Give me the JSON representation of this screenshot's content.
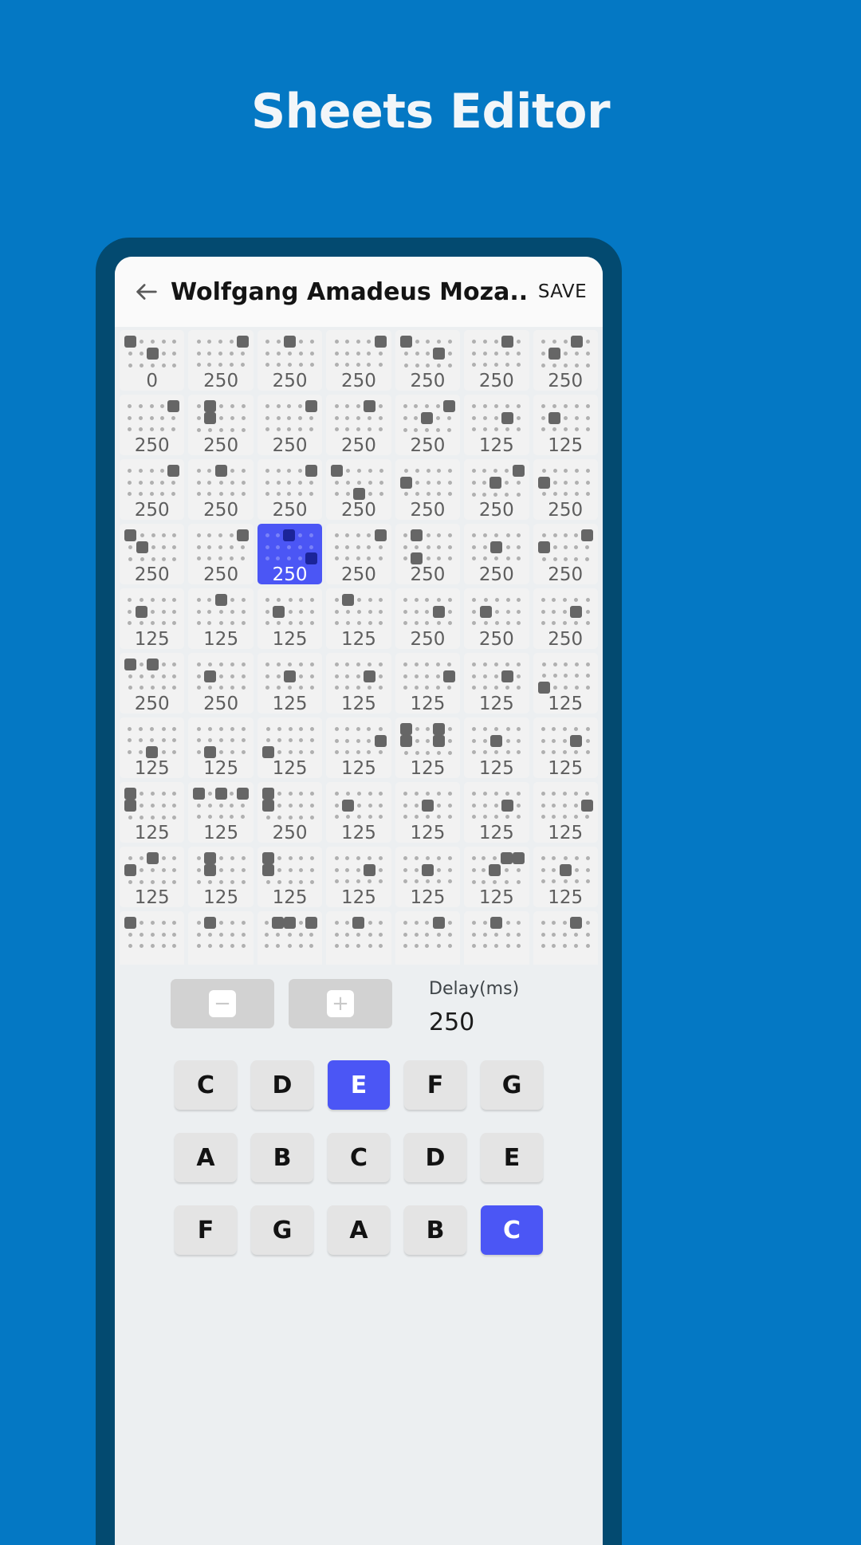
{
  "promo": {
    "title": "Sheets Editor"
  },
  "appbar": {
    "back_icon": "arrow-left-icon",
    "title": "Wolfgang Amadeus Moza...",
    "save_label": "SAVE"
  },
  "colors": {
    "page_background": "#0478c4",
    "phone_frame": "#034a70",
    "screen_background": "#eceff1",
    "appbar_background": "#fafafa",
    "cell_background": "#f2f2f2",
    "accent_selected": "#4b56f5",
    "dot_off": "#b0b0b0",
    "dot_on": "#666666",
    "key_background": "#e4e4e4"
  },
  "grid": {
    "columns": 7,
    "dot_columns": 5,
    "dot_rows": 3,
    "rows": [
      [
        {
          "delay": "0",
          "notes": [
            [
              0,
              0
            ],
            [
              2,
              1
            ]
          ],
          "selected": false
        },
        {
          "delay": "250",
          "notes": [
            [
              4,
              0
            ]
          ],
          "selected": false
        },
        {
          "delay": "250",
          "notes": [
            [
              2,
              0
            ]
          ],
          "selected": false
        },
        {
          "delay": "250",
          "notes": [
            [
              4,
              0
            ]
          ],
          "selected": false
        },
        {
          "delay": "250",
          "notes": [
            [
              0,
              0
            ],
            [
              3,
              1
            ]
          ],
          "selected": false
        },
        {
          "delay": "250",
          "notes": [
            [
              3,
              0
            ]
          ],
          "selected": false
        },
        {
          "delay": "250",
          "notes": [
            [
              3,
              0
            ],
            [
              1,
              1
            ]
          ],
          "selected": false
        }
      ],
      [
        {
          "delay": "250",
          "notes": [
            [
              4,
              0
            ]
          ],
          "selected": false
        },
        {
          "delay": "250",
          "notes": [
            [
              1,
              0
            ],
            [
              1,
              1
            ]
          ],
          "selected": false
        },
        {
          "delay": "250",
          "notes": [
            [
              4,
              0
            ]
          ],
          "selected": false
        },
        {
          "delay": "250",
          "notes": [
            [
              3,
              0
            ]
          ],
          "selected": false
        },
        {
          "delay": "250",
          "notes": [
            [
              4,
              0
            ],
            [
              2,
              1
            ]
          ],
          "selected": false
        },
        {
          "delay": "125",
          "notes": [
            [
              3,
              1
            ]
          ],
          "selected": false
        },
        {
          "delay": "125",
          "notes": [
            [
              1,
              1
            ]
          ],
          "selected": false
        }
      ],
      [
        {
          "delay": "250",
          "notes": [
            [
              4,
              0
            ]
          ],
          "selected": false
        },
        {
          "delay": "250",
          "notes": [
            [
              2,
              0
            ]
          ],
          "selected": false
        },
        {
          "delay": "250",
          "notes": [
            [
              4,
              0
            ]
          ],
          "selected": false
        },
        {
          "delay": "250",
          "notes": [
            [
              0,
              0
            ],
            [
              2,
              2
            ]
          ],
          "selected": false
        },
        {
          "delay": "250",
          "notes": [
            [
              0,
              1
            ]
          ],
          "selected": false
        },
        {
          "delay": "250",
          "notes": [
            [
              4,
              0
            ],
            [
              2,
              1
            ]
          ],
          "selected": false
        },
        {
          "delay": "250",
          "notes": [
            [
              0,
              1
            ]
          ],
          "selected": false
        }
      ],
      [
        {
          "delay": "250",
          "notes": [
            [
              0,
              0
            ],
            [
              1,
              1
            ]
          ],
          "selected": false
        },
        {
          "delay": "250",
          "notes": [
            [
              4,
              0
            ]
          ],
          "selected": false
        },
        {
          "delay": "250",
          "notes": [
            [
              2,
              0
            ],
            [
              4,
              2
            ]
          ],
          "selected": true
        },
        {
          "delay": "250",
          "notes": [
            [
              4,
              0
            ]
          ],
          "selected": false
        },
        {
          "delay": "250",
          "notes": [
            [
              1,
              0
            ],
            [
              1,
              2
            ]
          ],
          "selected": false
        },
        {
          "delay": "250",
          "notes": [
            [
              2,
              1
            ]
          ],
          "selected": false
        },
        {
          "delay": "250",
          "notes": [
            [
              0,
              1
            ],
            [
              4,
              0
            ]
          ],
          "selected": false
        }
      ],
      [
        {
          "delay": "125",
          "notes": [
            [
              1,
              1
            ]
          ],
          "selected": false
        },
        {
          "delay": "125",
          "notes": [
            [
              2,
              0
            ]
          ],
          "selected": false
        },
        {
          "delay": "125",
          "notes": [
            [
              1,
              1
            ]
          ],
          "selected": false
        },
        {
          "delay": "125",
          "notes": [
            [
              1,
              0
            ]
          ],
          "selected": false
        },
        {
          "delay": "250",
          "notes": [
            [
              3,
              1
            ]
          ],
          "selected": false
        },
        {
          "delay": "250",
          "notes": [
            [
              1,
              1
            ]
          ],
          "selected": false
        },
        {
          "delay": "250",
          "notes": [
            [
              3,
              1
            ]
          ],
          "selected": false
        }
      ],
      [
        {
          "delay": "250",
          "notes": [
            [
              0,
              0
            ],
            [
              2,
              0
            ]
          ],
          "selected": false
        },
        {
          "delay": "250",
          "notes": [
            [
              1,
              1
            ]
          ],
          "selected": false
        },
        {
          "delay": "125",
          "notes": [
            [
              2,
              1
            ]
          ],
          "selected": false
        },
        {
          "delay": "125",
          "notes": [
            [
              3,
              1
            ]
          ],
          "selected": false
        },
        {
          "delay": "125",
          "notes": [
            [
              4,
              1
            ]
          ],
          "selected": false
        },
        {
          "delay": "125",
          "notes": [
            [
              3,
              1
            ]
          ],
          "selected": false
        },
        {
          "delay": "125",
          "notes": [
            [
              0,
              2
            ]
          ],
          "selected": false
        }
      ],
      [
        {
          "delay": "125",
          "notes": [
            [
              2,
              2
            ]
          ],
          "selected": false
        },
        {
          "delay": "125",
          "notes": [
            [
              1,
              2
            ]
          ],
          "selected": false
        },
        {
          "delay": "125",
          "notes": [
            [
              0,
              2
            ]
          ],
          "selected": false
        },
        {
          "delay": "125",
          "notes": [
            [
              4,
              1
            ]
          ],
          "selected": false
        },
        {
          "delay": "125",
          "notes": [
            [
              0,
              0
            ],
            [
              3,
              0
            ],
            [
              0,
              1
            ],
            [
              3,
              1
            ]
          ],
          "selected": false
        },
        {
          "delay": "125",
          "notes": [
            [
              2,
              1
            ]
          ],
          "selected": false
        },
        {
          "delay": "125",
          "notes": [
            [
              3,
              1
            ]
          ],
          "selected": false
        }
      ],
      [
        {
          "delay": "125",
          "notes": [
            [
              0,
              0
            ],
            [
              0,
              1
            ]
          ],
          "selected": false
        },
        {
          "delay": "125",
          "notes": [
            [
              0,
              0
            ],
            [
              2,
              0
            ],
            [
              4,
              0
            ]
          ],
          "selected": false
        },
        {
          "delay": "250",
          "notes": [
            [
              0,
              0
            ],
            [
              0,
              1
            ]
          ],
          "selected": false
        },
        {
          "delay": "125",
          "notes": [
            [
              1,
              1
            ]
          ],
          "selected": false
        },
        {
          "delay": "125",
          "notes": [
            [
              2,
              1
            ]
          ],
          "selected": false
        },
        {
          "delay": "125",
          "notes": [
            [
              3,
              1
            ]
          ],
          "selected": false
        },
        {
          "delay": "125",
          "notes": [
            [
              4,
              1
            ]
          ],
          "selected": false
        }
      ],
      [
        {
          "delay": "125",
          "notes": [
            [
              0,
              1
            ],
            [
              2,
              0
            ]
          ],
          "selected": false
        },
        {
          "delay": "125",
          "notes": [
            [
              1,
              0
            ],
            [
              1,
              1
            ]
          ],
          "selected": false
        },
        {
          "delay": "125",
          "notes": [
            [
              0,
              0
            ],
            [
              0,
              1
            ]
          ],
          "selected": false
        },
        {
          "delay": "125",
          "notes": [
            [
              3,
              1
            ]
          ],
          "selected": false
        },
        {
          "delay": "125",
          "notes": [
            [
              2,
              1
            ]
          ],
          "selected": false
        },
        {
          "delay": "125",
          "notes": [
            [
              3,
              0
            ],
            [
              4,
              0
            ],
            [
              2,
              1
            ]
          ],
          "selected": false
        },
        {
          "delay": "125",
          "notes": [
            [
              2,
              1
            ]
          ],
          "selected": false
        }
      ],
      [
        {
          "delay": "",
          "notes": [
            [
              0,
              0
            ]
          ],
          "selected": false
        },
        {
          "delay": "",
          "notes": [
            [
              1,
              0
            ]
          ],
          "selected": false
        },
        {
          "delay": "",
          "notes": [
            [
              1,
              0
            ],
            [
              2,
              0
            ],
            [
              4,
              0
            ]
          ],
          "selected": false
        },
        {
          "delay": "",
          "notes": [
            [
              2,
              0
            ]
          ],
          "selected": false
        },
        {
          "delay": "",
          "notes": [
            [
              3,
              0
            ]
          ],
          "selected": false
        },
        {
          "delay": "",
          "notes": [
            [
              2,
              0
            ]
          ],
          "selected": false
        },
        {
          "delay": "",
          "notes": [
            [
              3,
              0
            ]
          ],
          "selected": false
        }
      ]
    ]
  },
  "delay_controls": {
    "minus_label": "−",
    "plus_label": "+",
    "label": "Delay(ms)",
    "value": "250"
  },
  "keyboard": {
    "rows": [
      [
        {
          "label": "C",
          "active": false
        },
        {
          "label": "D",
          "active": false
        },
        {
          "label": "E",
          "active": true
        },
        {
          "label": "F",
          "active": false
        },
        {
          "label": "G",
          "active": false
        }
      ],
      [
        {
          "label": "A",
          "active": false
        },
        {
          "label": "B",
          "active": false
        },
        {
          "label": "C",
          "active": false
        },
        {
          "label": "D",
          "active": false
        },
        {
          "label": "E",
          "active": false
        }
      ],
      [
        {
          "label": "F",
          "active": false
        },
        {
          "label": "G",
          "active": false
        },
        {
          "label": "A",
          "active": false
        },
        {
          "label": "B",
          "active": false
        },
        {
          "label": "C",
          "active": true
        }
      ]
    ]
  }
}
